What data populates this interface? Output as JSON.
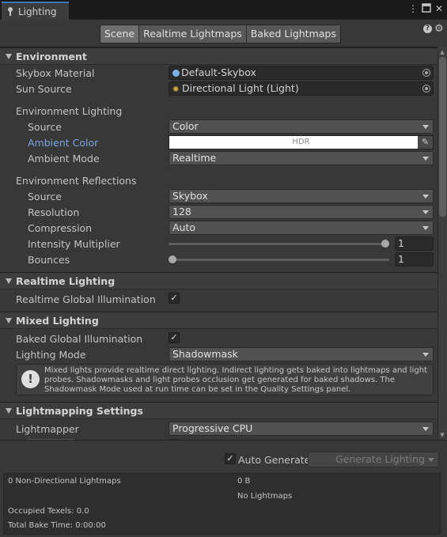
{
  "window": {
    "tab_title": "Lighting",
    "menu_icon": "kebab-menu-icon",
    "maximize_icon": "maximize-icon",
    "close_icon": "close-icon"
  },
  "toolbar": {
    "tabs": [
      "Scene",
      "Realtime Lightmaps",
      "Baked Lightmaps"
    ],
    "active_tab": "Scene",
    "help_icon": "?",
    "settings_icon": "gear-icon"
  },
  "environment": {
    "header": "Environment",
    "skybox_material_label": "Skybox Material",
    "skybox_material_value": "Default-Skybox",
    "sun_source_label": "Sun Source",
    "sun_source_value": "Directional Light (Light)",
    "env_lighting_header": "Environment Lighting",
    "source_label": "Source",
    "source_value": "Color",
    "ambient_color_label": "Ambient Color",
    "ambient_color_value": "HDR",
    "ambient_color_hex": "#ffffff",
    "ambient_mode_label": "Ambient Mode",
    "ambient_mode_value": "Realtime",
    "env_reflections_header": "Environment Reflections",
    "refl_source_label": "Source",
    "refl_source_value": "Skybox",
    "resolution_label": "Resolution",
    "resolution_value": "128",
    "compression_label": "Compression",
    "compression_value": "Auto",
    "intensity_label": "Intensity Multiplier",
    "intensity_value": "1",
    "intensity_fraction": 1.0,
    "bounces_label": "Bounces",
    "bounces_value": "1",
    "bounces_fraction": 0.0
  },
  "realtime": {
    "header": "Realtime Lighting",
    "gi_label": "Realtime Global Illumination (Depre",
    "gi_checked": true
  },
  "mixed": {
    "header": "Mixed Lighting",
    "baked_gi_label": "Baked Global Illumination",
    "baked_gi_checked": true,
    "lighting_mode_label": "Lighting Mode",
    "lighting_mode_value": "Shadowmask",
    "help_line1": "Mixed lights provide realtime direct lighting. Indirect lighting gets baked into lightmaps and light",
    "help_line2": "probes. Shadowmasks and light probes occlusion get generated for baked shadows. The",
    "help_line3": "Shadowmask Mode used at run time can be set in the Quality Settings panel."
  },
  "lightmapping": {
    "header": "Lightmapping Settings",
    "lightmapper_label": "Lightmapper",
    "lightmapper_value": "Progressive CPU"
  },
  "bottom": {
    "auto_generate_label": "Auto Generate",
    "auto_generate_checked": true,
    "generate_button": "Generate Lighting"
  },
  "stats": {
    "lightmaps_label": "0 Non-Directional Lightmaps",
    "size_value": "0 B",
    "no_lightmaps": "No Lightmaps",
    "occupied_texels": "Occupied Texels: 0.0",
    "total_bake_time": "Total Bake Time: 0:00:00"
  }
}
